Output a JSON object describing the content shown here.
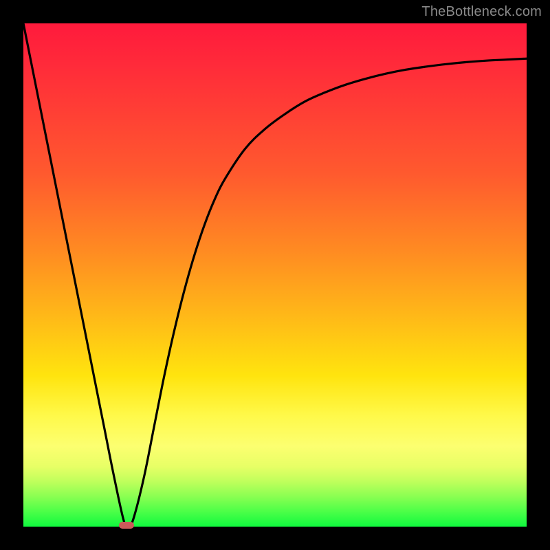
{
  "watermark": "TheBottleneck.com",
  "chart_data": {
    "type": "line",
    "title": "",
    "xlabel": "",
    "ylabel": "",
    "xlim": [
      0,
      100
    ],
    "ylim": [
      0,
      100
    ],
    "grid": false,
    "legend": false,
    "series": [
      {
        "name": "bottleneck-curve",
        "x": [
          0,
          2,
          4,
          6,
          8,
          10,
          12,
          14,
          16,
          18,
          20,
          21,
          22,
          24,
          26,
          28,
          30,
          32,
          34,
          36,
          38,
          40,
          44,
          48,
          52,
          56,
          60,
          64,
          68,
          72,
          76,
          80,
          84,
          88,
          92,
          96,
          100
        ],
        "y": [
          100,
          90,
          80,
          70,
          60,
          50,
          40,
          30,
          20,
          10,
          1,
          0,
          2,
          10,
          20,
          30,
          39,
          47,
          54,
          60,
          65,
          69,
          75,
          79,
          82,
          84.5,
          86.3,
          87.8,
          89,
          90,
          90.8,
          91.4,
          91.9,
          92.3,
          92.6,
          92.8,
          93
        ]
      }
    ],
    "marker": {
      "x": 20.5,
      "y": 0,
      "width_pct": 3.0,
      "height_pct": 1.3
    },
    "colors": {
      "curve": "#000000",
      "marker": "#cc5a5a",
      "gradient_top": "#ff1a3c",
      "gradient_bottom": "#10f93e"
    }
  }
}
